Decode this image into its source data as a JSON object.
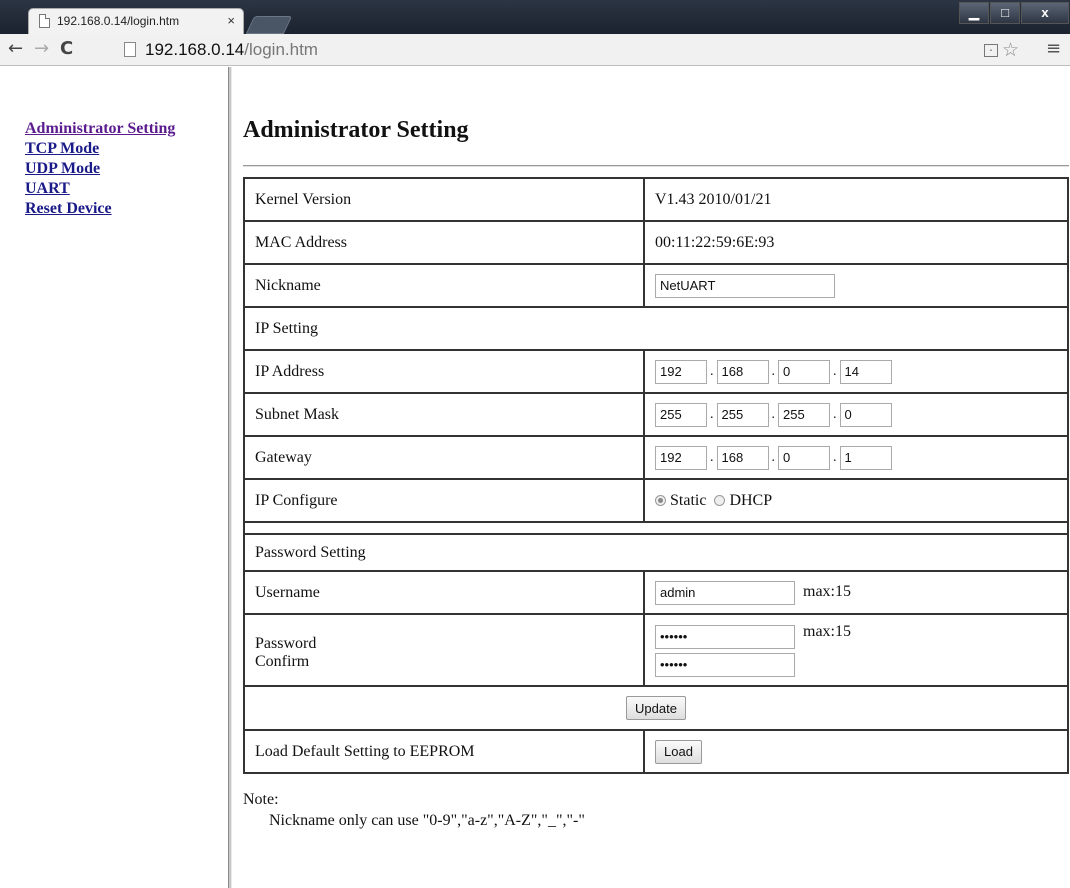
{
  "browser": {
    "tab_title": "192.168.0.14/login.htm",
    "tab_close": "×",
    "url_host": "192.168.0.14",
    "url_path": "/login.htm",
    "window_controls": {
      "minimize": "▁",
      "maximize": "□",
      "close": "x"
    },
    "nav": {
      "back": "←",
      "forward": "→",
      "reload": "C"
    },
    "icons": [
      "page-icon",
      "translate-icon",
      "star-icon",
      "menu-icon"
    ]
  },
  "sidebar": {
    "items": [
      {
        "label": "Administrator Setting"
      },
      {
        "label": "TCP Mode"
      },
      {
        "label": "UDP Mode"
      },
      {
        "label": "UART"
      },
      {
        "label": "Reset Device"
      }
    ]
  },
  "page": {
    "title": "Administrator Setting",
    "kernel_version": {
      "label": "Kernel Version",
      "value": "V1.43 2010/01/21"
    },
    "mac_address": {
      "label": "MAC Address",
      "value": "00:11:22:59:6E:93"
    },
    "nickname": {
      "label": "Nickname",
      "value": "NetUART"
    },
    "ip_setting_header": "IP Setting",
    "ip_address": {
      "label": "IP Address",
      "octets": [
        "192",
        "168",
        "0",
        "14"
      ]
    },
    "subnet_mask": {
      "label": "Subnet Mask",
      "octets": [
        "255",
        "255",
        "255",
        "0"
      ]
    },
    "gateway": {
      "label": "Gateway",
      "octets": [
        "192",
        "168",
        "0",
        "1"
      ]
    },
    "ip_configure": {
      "label": "IP Configure",
      "options": [
        "Static",
        "DHCP"
      ],
      "selected": "Static"
    },
    "password_setting_header": "Password Setting",
    "username": {
      "label": "Username",
      "value": "admin",
      "hint": "max:15"
    },
    "password": {
      "label": "Password",
      "confirm_label": "Confirm",
      "value": "••••••",
      "confirm_value": "••••••",
      "hint": "max:15"
    },
    "update_button": "Update",
    "load_default": {
      "label": "Load Default Setting to EEPROM",
      "button": "Load"
    },
    "note_title": "Note:",
    "note_text": "Nickname only can use \"0-9\",\"a-z\",\"A-Z\",\"_\",\"-\""
  }
}
